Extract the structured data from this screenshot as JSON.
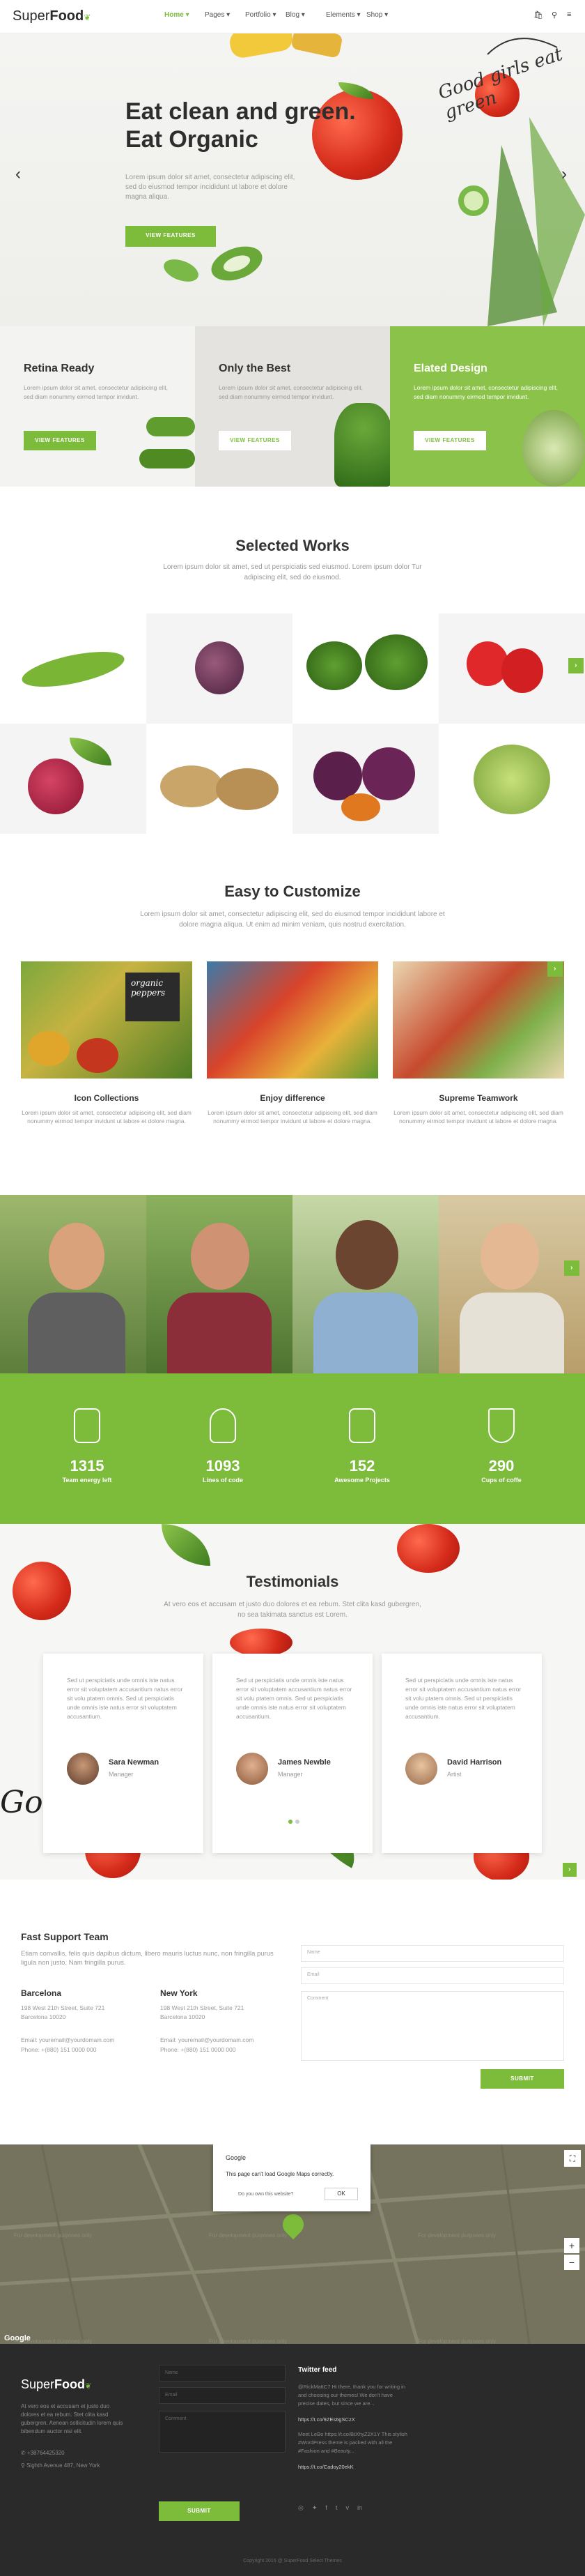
{
  "brand": {
    "name_plain": "Super",
    "name_bold": "Food"
  },
  "nav": {
    "items": [
      "Home",
      "Pages",
      "Portfolio",
      "Blog",
      "Elements",
      "Shop"
    ]
  },
  "hero": {
    "title_line1": "Eat clean and green.",
    "title_line2": "Eat Organic",
    "text": "Lorem ipsum dolor sit amet, consectetur adipiscing elit, sed do eiusmod tempor incididunt ut labore et dolore magna aliqua.",
    "button": "VIEW FEATURES",
    "script_text": "Good girls eat green"
  },
  "features": [
    {
      "title": "Retina Ready",
      "text": "Lorem ipsum dolor sit amet, consectetur adipiscing elit, sed diam nonummy eirmod tempor invidunt.",
      "button": "VIEW FEATURES"
    },
    {
      "title": "Only the Best",
      "text": "Lorem ipsum dolor sit amet, consectetur adipiscing elit, sed diam nonummy eirmod tempor invidunt.",
      "button": "VIEW FEATURES"
    },
    {
      "title": "Elated Design",
      "text": "Lorem ipsum dolor sit amet, consectetur adipiscing elit, sed diam nonummy eirmod tempor invidunt.",
      "button": "VIEW FEATURES"
    }
  ],
  "works": {
    "title": "Selected Works",
    "text": "Lorem ipsum dolor sit amet, sed ut perspiciatis sed eiusmod. Lorem ipsum dolor Tur adipiscing elit, sed do eiusmod."
  },
  "customize": {
    "title": "Easy to Customize",
    "text": "Lorem ipsum dolor sit amet, consectetur adipiscing elit, sed do eiusmod tempor incididunt labore et dolore magna aliqua. Ut enim ad minim veniam, quis nostrud exercitation.",
    "items": [
      {
        "title": "Icon Collections",
        "text": "Lorem ipsum dolor sit amet, consectetur adipiscing elit, sed diam nonummy eirmod tempor invidunt ut labore et dolore magna."
      },
      {
        "title": "Enjoy difference",
        "text": "Lorem ipsum dolor sit amet, consectetur adipiscing elit, sed diam nonummy eirmod tempor invidunt ut labore et dolore magna."
      },
      {
        "title": "Supreme Teamwork",
        "text": "Lorem ipsum dolor sit amet, consectetur adipiscing elit, sed diam nonummy eirmod tempor invidunt ut labore et dolore magna."
      }
    ],
    "sign_text": "organic peppers"
  },
  "stats": [
    {
      "number": "1315",
      "label": "Team energy left"
    },
    {
      "number": "1093",
      "label": "Lines of code"
    },
    {
      "number": "152",
      "label": "Awesome Projects"
    },
    {
      "number": "290",
      "label": "Cups of coffe"
    }
  ],
  "testimonials": {
    "title": "Testimonials",
    "text": "At vero eos et accusam et justo duo dolores et ea rebum. Stet clita kasd gubergren, no sea takimata sanctus est Lorem.",
    "items": [
      {
        "text": "Sed ut perspiciatis unde omnis iste natus error sit voluptatem accusantium natus error sit volu ptatem omnis. Sed ut perspiciatis unde omnis iste natus error sit voluptatem accusantium.",
        "name": "Sara Newman",
        "role": "Manager"
      },
      {
        "text": "Sed ut perspiciatis unde omnis iste natus error sit voluptatem accusantium natus error sit volu ptatem omnis. Sed ut perspiciatis unde omnis iste natus error sit voluptatem accusantium.",
        "name": "James Newble",
        "role": "Manager"
      },
      {
        "text": "Sed ut perspiciatis unde omnis iste natus error sit voluptatem accusantium natus error sit volu ptatem omnis. Sed ut perspiciatis unde omnis iste natus error sit voluptatem accusantium.",
        "name": "David Harrison",
        "role": "Artist"
      }
    ],
    "script_text": "Go green"
  },
  "contact": {
    "title": "Fast Support Team",
    "text": "Etiam convallis, felis quis dapibus dictum, libero mauris luctus nunc, non fringilla purus ligula non justo. Nam fringilla purus.",
    "offices": [
      {
        "city": "Barcelona",
        "address": "198 West 21th Street, Suite 721 Barcelona 10020",
        "email": "Email: youremail@yourdomain.com",
        "phone": "Phone: +(880) 151 0000 000"
      },
      {
        "city": "New York",
        "address": "198 West 21th Street, Suite 721 Barcelona 10020",
        "email": "Email: youremail@yourdomain.com",
        "phone": "Phone: +(880) 151 0000 000"
      }
    ],
    "form": {
      "name": "Name",
      "email": "Email",
      "comment": "Comment",
      "submit": "SUBMIT"
    }
  },
  "map": {
    "dialog_title": "Google",
    "dialog_text": "This page can't load Google Maps correctly.",
    "dialog_question": "Do you own this website?",
    "dialog_ok": "OK",
    "watermark": "For development purposes only",
    "google": "Google"
  },
  "footer": {
    "text": "At vero eos et accusam et justo duo dolores et ea rebum. Stet clita kasd gubergren. Aenean sollicitudin lorem quis bibendum auctor nisi elit.",
    "phone": "+38764425320",
    "address": "Sighth Avenue 487, New York",
    "form": {
      "name": "Name",
      "email": "Email",
      "message": "Comment",
      "submit": "SUBMIT"
    },
    "twitter_title": "Twitter feed",
    "tweets": [
      {
        "text": "@RickMattC7 Hi there, thank you for writing in and choosing our themes! We don't have precise dates, but since we are...",
        "link": "https://t.co/9ZEs6gSCzX"
      },
      {
        "text": "Meet LeBo https://t.co/BtXhyZ2X1Y This stylish #WordPress theme is packed with all the #Fashion and #Beauty...",
        "link": "https://t.co/Cadoy20ekK"
      }
    ],
    "copyright": "Copyright 2016 @ SuperFood Select Themes"
  },
  "colors": {
    "accent": "#7dbb3b",
    "dark": "#2a2a2a"
  }
}
